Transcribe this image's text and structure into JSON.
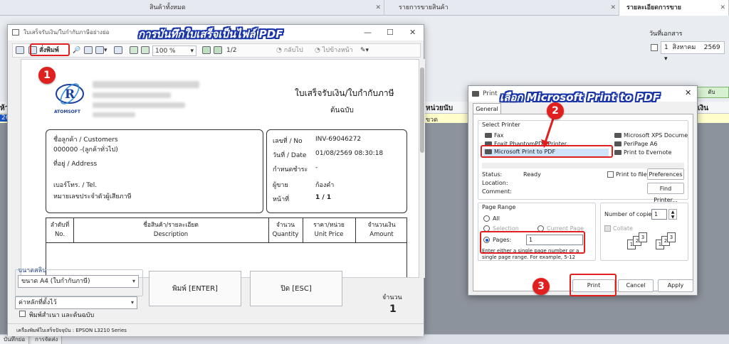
{
  "app": {
    "tabs": [
      {
        "label": "สินค้าทั้งหมด"
      },
      {
        "label": "รายการขายสินค้า"
      },
      {
        "label": "รายละเอียดการขาย"
      }
    ],
    "date_label": "วันที่เอกสาร",
    "date_day": "1",
    "date_month": "สิงหาคม",
    "date_year": "2569",
    "col_unit": "หน่วยนับ",
    "col_money": "เงิน",
    "row_num": "26",
    "row_unit": "ขวด",
    "green_btn": "ดับ",
    "left_hdr": "ห้า",
    "bottom_tabs": [
      {
        "label": "บันทึกย่อ"
      },
      {
        "label": "การจัดส่ง"
      }
    ]
  },
  "preview": {
    "window_title": "ใบเสร็จรับเงิน/ใบกำกับภาษีอย่างย่อ",
    "toolbar": {
      "print_label": "สั่งพิมพ์",
      "zoom": "100 %",
      "page_indicator": "1/2",
      "back_label": "กลับไป",
      "forward_label": "ไปข้างหน้า"
    },
    "doc": {
      "logo_text": "ATOMSOFT",
      "title": "ใบเสร็จรับเงิน/ใบกำกับภาษี",
      "subtitle": "ต้นฉบับ",
      "customer_label": "ชื่อลูกค้า / Customers",
      "customer_value": "000000 -(ลูกค้าทั่วไป)",
      "address_label": "ที่อยู่ / Address",
      "phone_label": "เบอร์โทร. / Tel.",
      "taxid_label": "หมายเลขประจำตัวผู้เสียภาษี",
      "no_label": "เลขที่ / No",
      "no_value": "INV-69046272",
      "date_label": "วันที่ / Date",
      "date_value": "01/08/2569 08:30:18",
      "due_label": "กำหนดชำระ",
      "due_value": "-",
      "seller_label": "ผู้ขาย",
      "seller_value": "ก้องคำ",
      "page_label": "หน้าที่",
      "page_value": "1 / 1",
      "table_headers": [
        {
          "th": "ลำดับที่",
          "en": "No."
        },
        {
          "th": "ชื่อสินค้า/รายละเอียด",
          "en": "Description"
        },
        {
          "th": "จำนวน",
          "en": "Quantity"
        },
        {
          "th": "ราคา/หน่วย",
          "en": "Unit Price"
        },
        {
          "th": "จำนวนเงิน",
          "en": "Amount"
        }
      ]
    },
    "slip_size_label": "ขนาดสลิป",
    "slip_size_value": "ขนาด A4 (ใบกำกับภาษี)",
    "default_value": "ค่าหลักที่ตั้งไว้",
    "copy_checkbox": "พิมพ์สำเนา และต้นฉบับ",
    "print_button": "พิมพ์ [ENTER]",
    "close_button": "ปิด [ESC]",
    "qty_label": "จำนวน",
    "qty_value": "1",
    "status": "เครื่องพิมพ์ใบเสร็จปัจจุบัน : EPSON L3210 Series"
  },
  "print_dialog": {
    "title": "Print",
    "tab": "General",
    "select_printer_label": "Select Printer",
    "printers_left": [
      {
        "name": "Fax"
      },
      {
        "name": "Foxit PhantomPDF Printer"
      },
      {
        "name": "Microsoft Print to PDF"
      }
    ],
    "printers_right": [
      {
        "name": "Microsoft XPS Docume"
      },
      {
        "name": "PeriPage A6"
      },
      {
        "name": "Print to Evernote"
      }
    ],
    "status_label": "Status:",
    "status_value": "Ready",
    "location_label": "Location:",
    "comment_label": "Comment:",
    "print_to_file": "Print to file",
    "preferences": "Preferences",
    "find_printer": "Find Printer...",
    "page_range_label": "Page Range",
    "all_label": "All",
    "selection_label": "Selection",
    "current_page_label": "Current Page",
    "pages_label": "Pages:",
    "pages_value": "1",
    "hint": "Enter either a single page number or a single page range.  For example, 5-12",
    "copies_label": "Number of copies:",
    "copies_value": "1",
    "collate_label": "Collate",
    "print_btn": "Print",
    "cancel_btn": "Cancel",
    "apply_btn": "Apply"
  },
  "annotations": {
    "heading_left": "การบันทึกใบเสร็จเป็นไฟล์ PDF",
    "heading_right": "เลือก Microsoft Print to PDF",
    "step1": "1",
    "step2": "2",
    "step3": "3"
  },
  "colors": {
    "annotation_red": "#e0201e",
    "heading_outline": "#1a35a8"
  }
}
